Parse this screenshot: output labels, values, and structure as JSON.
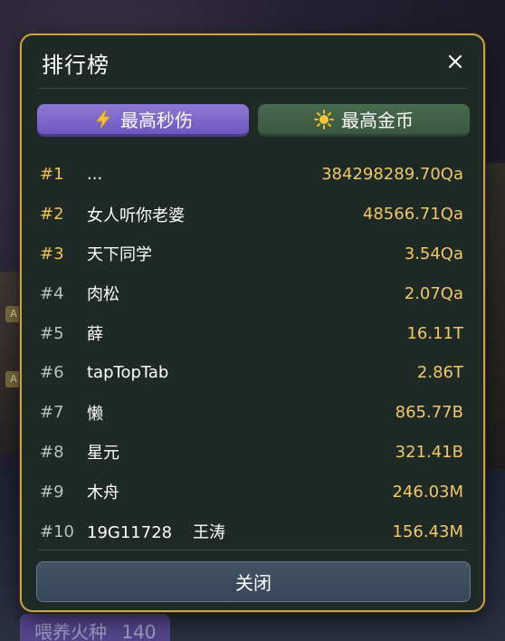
{
  "background": {
    "chip_label": "喂养火种",
    "chip_count": "140",
    "tag_a": "A",
    "tag_b": "A"
  },
  "modal": {
    "title": "排行榜",
    "close_icon": "close-icon",
    "tabs": [
      {
        "label": "最高秒伤",
        "icon": "lightning-icon",
        "active": true
      },
      {
        "label": "最高金币",
        "icon": "sun-icon",
        "active": false
      }
    ],
    "rows": [
      {
        "rank": "#1",
        "name": "...",
        "score": "384298289.70Qa"
      },
      {
        "rank": "#2",
        "name": "女人听你老婆",
        "score": "48566.71Qa"
      },
      {
        "rank": "#3",
        "name": "天下同学",
        "score": "3.54Qa"
      },
      {
        "rank": "#4",
        "name": "肉松",
        "score": "2.07Qa"
      },
      {
        "rank": "#5",
        "name": "薛",
        "score": "16.11T"
      },
      {
        "rank": "#6",
        "name": "tapTopTab",
        "score": "2.86T"
      },
      {
        "rank": "#7",
        "name": "懒",
        "score": "865.77B"
      },
      {
        "rank": "#8",
        "name": "星元",
        "score": "321.41B"
      },
      {
        "rank": "#9",
        "name": "木舟",
        "score": "246.03M"
      },
      {
        "rank": "#10",
        "name": "19G11728    王涛",
        "score": "156.43M"
      }
    ],
    "close_button_label": "关闭"
  },
  "colors": {
    "border_gold": "#c9a24a",
    "active_tab": "#7e67c9",
    "inactive_tab": "#41604a",
    "top_rank": "#f2c24a",
    "score": "#f0c868"
  }
}
